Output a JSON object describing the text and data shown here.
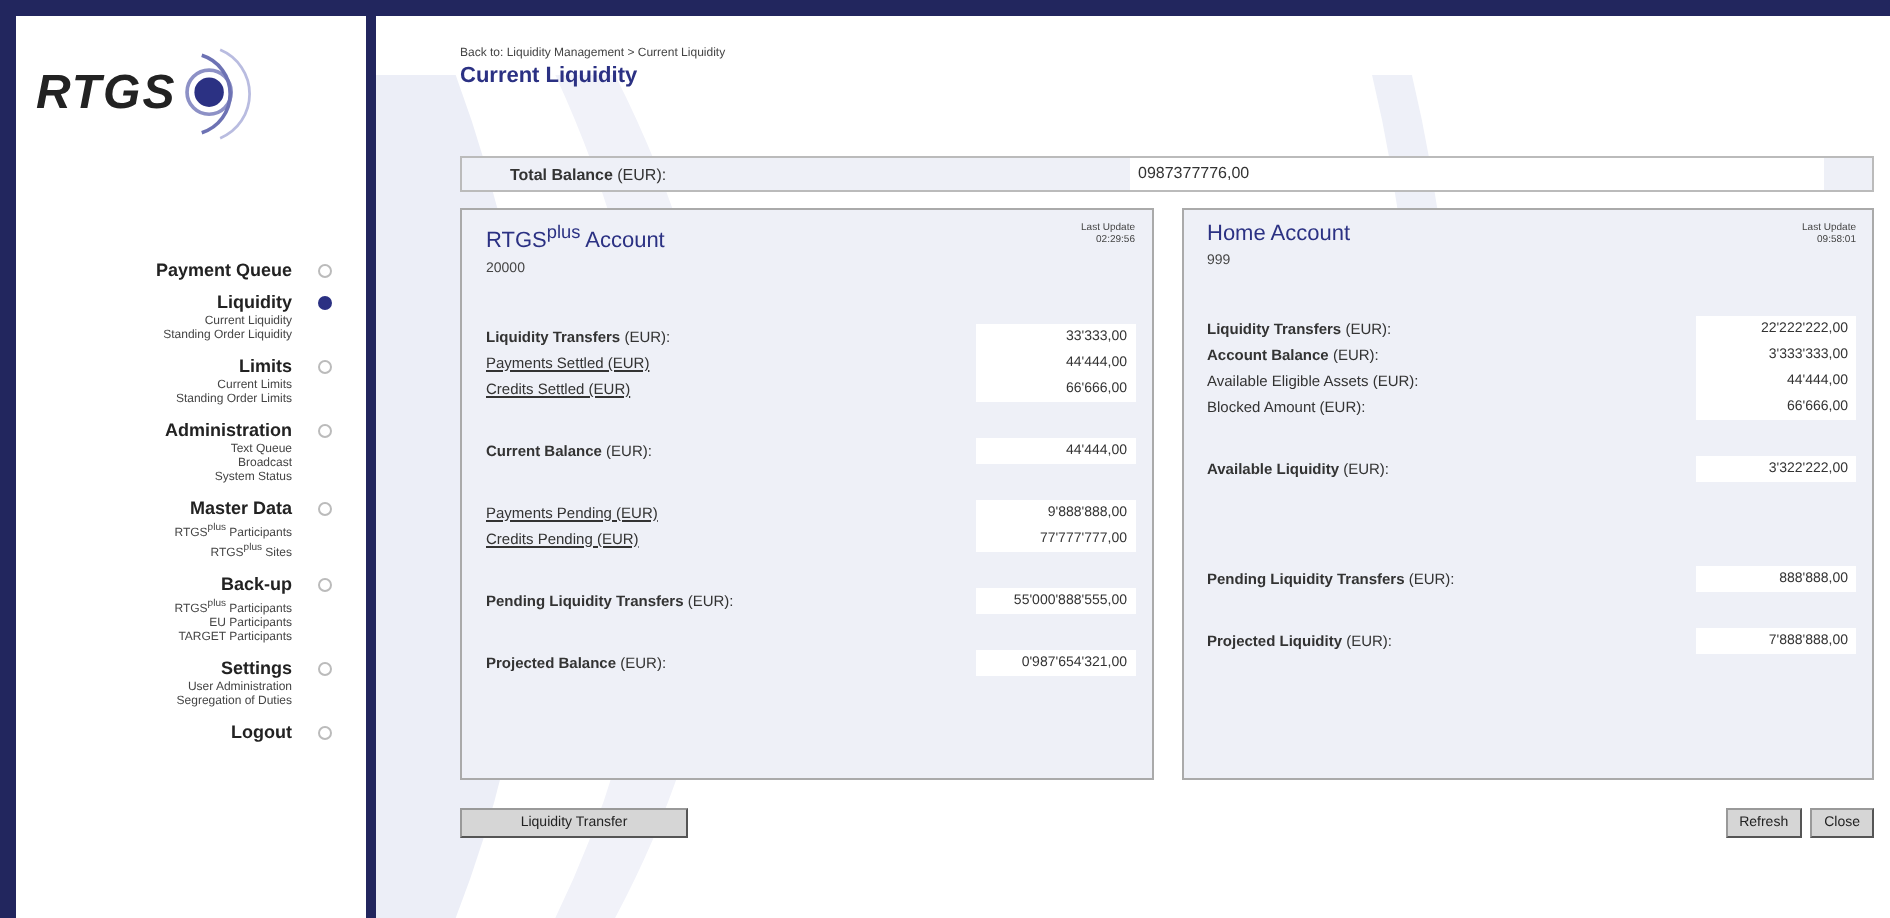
{
  "logo": {
    "text": "RTGS"
  },
  "sidebar": {
    "items": [
      {
        "label": "Payment Queue",
        "selected": false
      },
      {
        "label": "Liquidity",
        "selected": true,
        "children": [
          "Current Liquidity",
          "Standing Order Liquidity"
        ]
      },
      {
        "label": "Limits",
        "selected": false,
        "children": [
          "Current Limits",
          "Standing Order Limits"
        ]
      },
      {
        "label": "Administration",
        "selected": false,
        "children": [
          "Text Queue",
          "Broadcast",
          "System Status"
        ]
      },
      {
        "label": "Master Data",
        "selected": false,
        "children": [
          "RTGS$^{plus}$ Participants",
          "RTGS$^{plus}$ Sites"
        ]
      },
      {
        "label": "Back-up",
        "selected": false,
        "children": [
          "RTGS$^{plus}$ Participants",
          "EU Participants",
          "TARGET Participants"
        ]
      },
      {
        "label": "Settings",
        "selected": false,
        "children": [
          "User Administration",
          "Segregation of Duties"
        ]
      },
      {
        "label": "Logout",
        "selected": false
      }
    ]
  },
  "breadcrumb": "Back to: Liquidity Management > Current Liquidity",
  "page_title": "Current Liquidity",
  "total_balance": {
    "label": "**Total Balance** (EUR):",
    "value": "0987377776,00"
  },
  "panels": [
    {
      "title": "RTGS$^{plus}$ Account",
      "account": "20000",
      "update_label": "Last Update",
      "update_time": "02:29:56",
      "groups": [
        [
          {
            "kind": "bold",
            "label": "**Liquidity Transfers** (EUR):",
            "value": "33'333,00"
          },
          {
            "kind": "link",
            "label": "Payments Settled (EUR)",
            "value": "44'444,00"
          },
          {
            "kind": "link",
            "label": "Credits Settled (EUR)",
            "value": "66'666,00"
          }
        ],
        [
          {
            "kind": "bold",
            "label": "**Current Balance** (EUR):",
            "value": "44'444,00"
          }
        ],
        [
          {
            "kind": "link",
            "label": "Payments Pending (EUR)",
            "value": "9'888'888,00"
          },
          {
            "kind": "link",
            "label": "Credits Pending (EUR)",
            "value": "77'777'777,00"
          }
        ],
        [
          {
            "kind": "bold",
            "label": "**Pending Liquidity Transfers** (EUR):",
            "value": "55'000'888'555,00"
          }
        ],
        [
          {
            "kind": "bold",
            "label": "**Projected Balance** (EUR):",
            "value": "0'987'654'321,00"
          }
        ]
      ]
    },
    {
      "title": "Home Account",
      "account": "999",
      "update_label": "Last Update",
      "update_time": "09:58:01",
      "groups": [
        [
          {
            "kind": "bold",
            "label": "**Liquidity Transfers** (EUR):",
            "value": "22'222'222,00"
          },
          {
            "kind": "bold",
            "label": "**Account Balance** (EUR):",
            "value": "3'333'333,00"
          },
          {
            "kind": "plain",
            "label": "Available Eligible Assets (EUR):",
            "value": "44'444,00"
          },
          {
            "kind": "plain",
            "label": "Blocked Amount (EUR):",
            "value": "66'666,00"
          }
        ],
        [
          {
            "kind": "bold",
            "label": "**Available Liquidity** (EUR):",
            "value": "3'322'222,00"
          }
        ],
        [
          {
            "kind": "bold",
            "label": "**Pending Liquidity Transfers** (EUR):",
            "value": "888'888,00"
          }
        ],
        [
          {
            "kind": "bold",
            "label": "**Projected Liquidity** (EUR):",
            "value": "7'888'888,00"
          }
        ]
      ]
    }
  ],
  "buttons": {
    "left": [
      "Liquidity Transfer"
    ],
    "right": [
      "Refresh",
      "Close"
    ]
  }
}
